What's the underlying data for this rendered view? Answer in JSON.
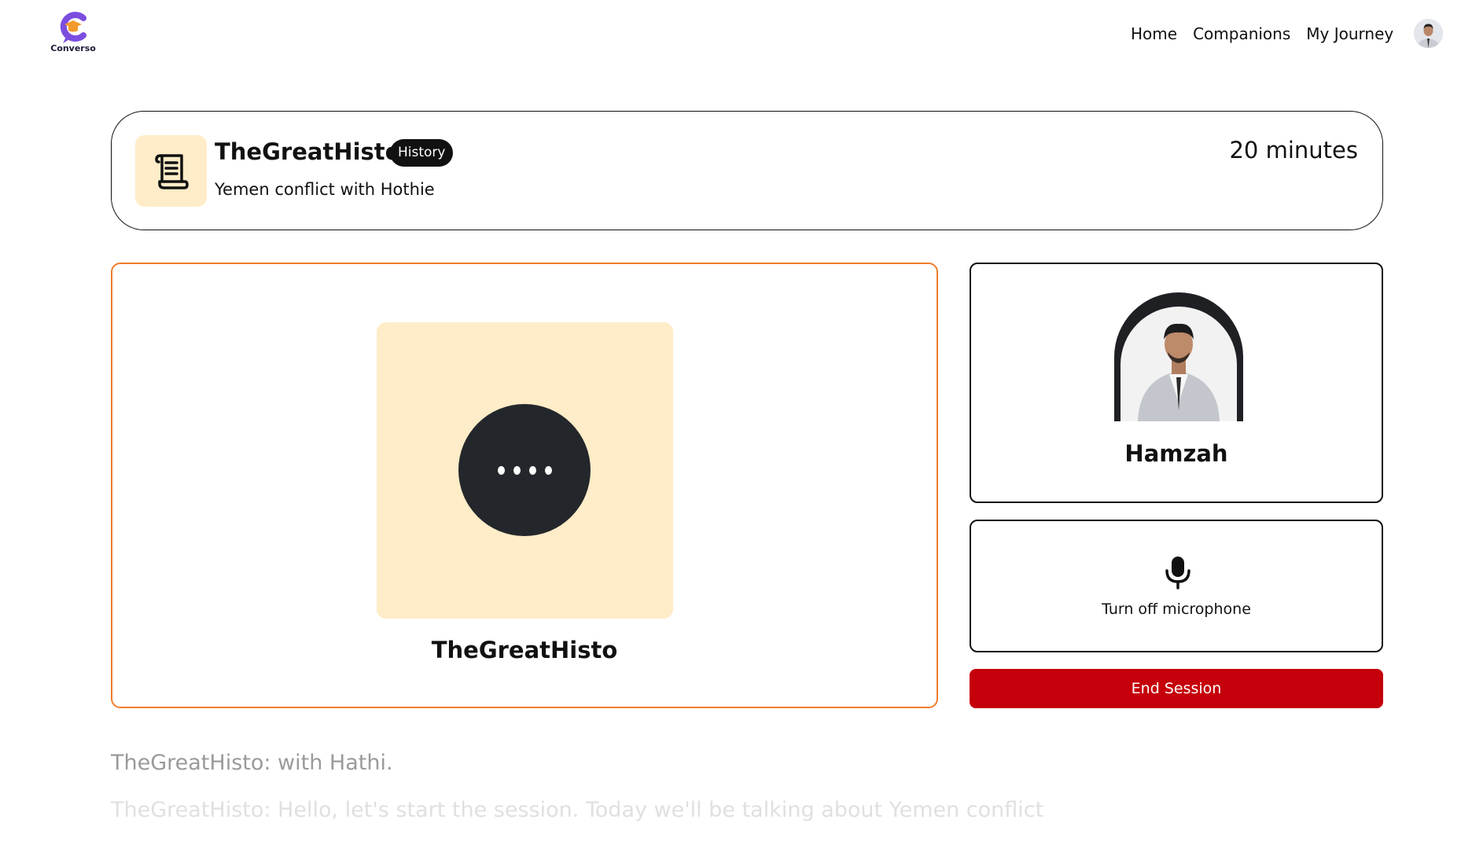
{
  "nav": {
    "brand": "Converso",
    "links": [
      "Home",
      "Companions",
      "My Journey"
    ]
  },
  "session": {
    "companion_name": "TheGreatHisto",
    "subject": "History",
    "topic": "Yemen conflict with Hothie",
    "duration": "20 minutes"
  },
  "companion_panel": {
    "name": "TheGreatHisto",
    "status_icon": "speaking-dots-icon"
  },
  "user_panel": {
    "name": "Hamzah"
  },
  "controls": {
    "mic_label": "Turn off microphone",
    "end_session_label": "End Session"
  },
  "transcript": [
    "TheGreatHisto: with Hathi.",
    "TheGreatHisto: Hello, let's start the session. Today we'll be talking about Yemen conflict"
  ],
  "colors": {
    "accent_orange": "#f07c2b",
    "companion_bg": "#ffecc8",
    "end_button": "#c5000b",
    "brand_purple": "#7b4ee0"
  }
}
